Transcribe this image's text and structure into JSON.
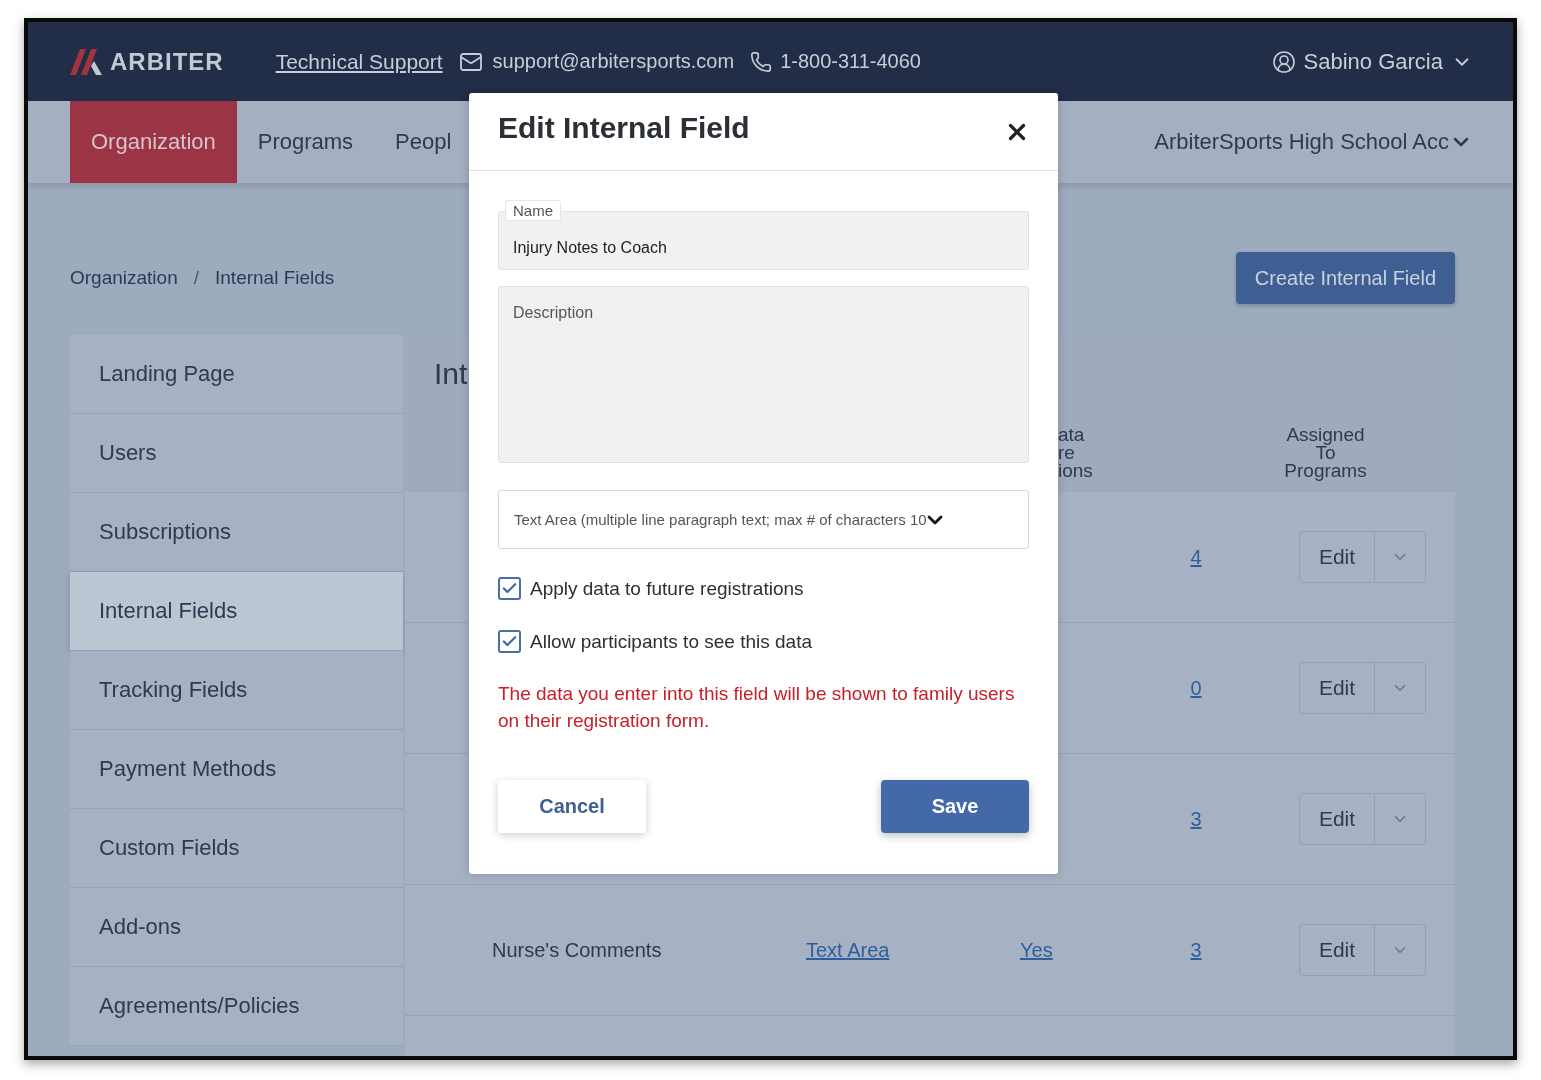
{
  "header": {
    "logo": "ARBITER",
    "support_link": "Technical Support",
    "email": "support@arbitersports.com",
    "phone": "1-800-311-4060",
    "user": "Sabino Garcia"
  },
  "nav": {
    "tabs": [
      {
        "label": "Organization",
        "selected": true
      },
      {
        "label": "Programs",
        "selected": false
      },
      {
        "label": "Peopl",
        "selected": false
      }
    ],
    "account": "ArbiterSports High School Acc"
  },
  "breadcrumb": {
    "items": [
      "Organization",
      "Internal Fields"
    ],
    "separator": "/"
  },
  "create_button": "Create Internal Field",
  "sidebar": {
    "items": [
      {
        "label": "Landing Page",
        "selected": false
      },
      {
        "label": "Users",
        "selected": false
      },
      {
        "label": "Subscriptions",
        "selected": false
      },
      {
        "label": "Internal Fields",
        "selected": true
      },
      {
        "label": "Tracking Fields",
        "selected": false
      },
      {
        "label": "Payment Methods",
        "selected": false
      },
      {
        "label": "Custom Fields",
        "selected": false
      },
      {
        "label": "Add-ons",
        "selected": false
      },
      {
        "label": "Agreements/Policies",
        "selected": false
      }
    ]
  },
  "panel": {
    "title": "Int",
    "columns": [
      [
        "ata",
        "re",
        "ions"
      ],
      [
        "Assigned",
        "To",
        "Programs"
      ]
    ],
    "rows": [
      {
        "assigned": "4",
        "action": "Edit"
      },
      {
        "assigned": "0",
        "action": "Edit"
      },
      {
        "assigned": "3",
        "action": "Edit"
      },
      {
        "name": "Nurse's Comments",
        "type": "Text Area",
        "data": "Yes",
        "assigned": "3",
        "action": "Edit"
      }
    ]
  },
  "modal": {
    "title": "Edit Internal Field",
    "name_field": {
      "label": "Name",
      "value": "Injury Notes to Coach"
    },
    "description_field": {
      "placeholder": "Description"
    },
    "type_select": {
      "value": "Text Area (multiple line paragraph text; max # of characters 10"
    },
    "checkboxes": [
      {
        "label": "Apply data to future registrations",
        "checked": true
      },
      {
        "label": "Allow participants to see this data",
        "checked": true
      }
    ],
    "warning": "The data you enter into this field will be shown to family users on their registration form.",
    "cancel": "Cancel",
    "save": "Save"
  }
}
